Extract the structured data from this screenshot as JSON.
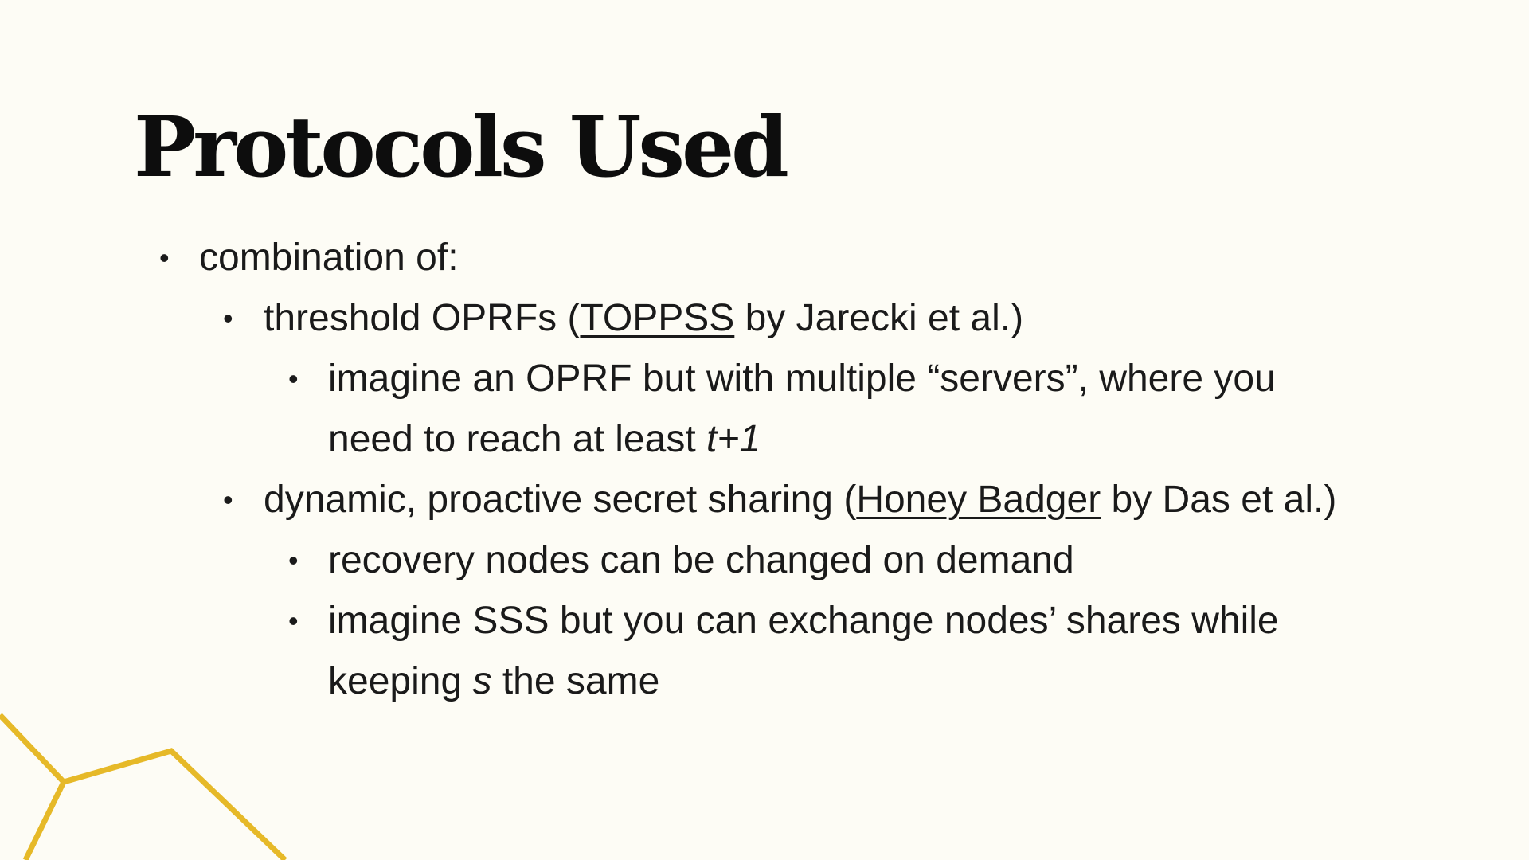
{
  "slide": {
    "title": "Protocols Used",
    "accent_color": "#e6b928",
    "bullets": {
      "b1": {
        "text": "combination of:"
      },
      "b2": {
        "before": "threshold OPRFs (",
        "link": "TOPPSS",
        "after": " by Jarecki et al.)"
      },
      "b3": {
        "line1": "imagine an OPRF but with multiple “servers”, where you",
        "line2_before": "need to reach at least ",
        "line2_italic": "t+1"
      },
      "b4": {
        "before": "dynamic, proactive secret sharing (",
        "link": "Honey Badger",
        "after": " by Das et al.)"
      },
      "b5": {
        "text": "recovery nodes can be changed on demand"
      },
      "b6": {
        "line1": "imagine SSS but you can exchange nodes’ shares while",
        "line2_before": "keeping ",
        "line2_italic": "s",
        "line2_after": " the same"
      }
    }
  }
}
